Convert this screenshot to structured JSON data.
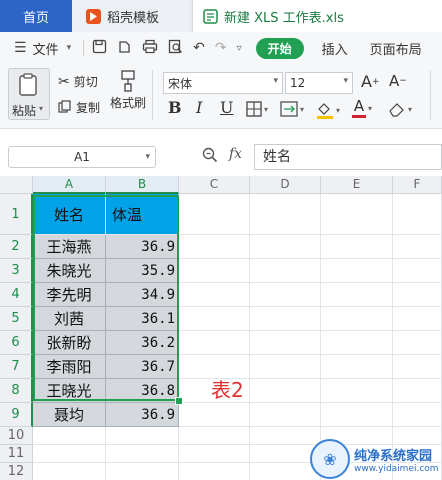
{
  "tabs": [
    {
      "label": "首页",
      "active": false
    },
    {
      "label": "稻壳模板",
      "active": false
    },
    {
      "label": "新建 XLS 工作表.xls",
      "active": true
    }
  ],
  "menu": {
    "file": "文件",
    "start": "开始",
    "insert": "插入",
    "layout": "页面布局"
  },
  "ribbon": {
    "paste": "粘贴",
    "cut": "剪切",
    "copy": "复制",
    "format_painter": "格式刷",
    "font_name": "宋体",
    "font_size": "12",
    "bold": "B",
    "italic": "I",
    "underline": "U",
    "grow_font": "A",
    "shrink_font": "A"
  },
  "formula_bar": {
    "cell_ref": "A1",
    "fx": "fx",
    "content": "姓名"
  },
  "sheet": {
    "columns": [
      "A",
      "B",
      "C",
      "D",
      "E",
      "F"
    ],
    "rows": [
      "1",
      "2",
      "3",
      "4",
      "5",
      "6",
      "7",
      "8",
      "9",
      "10",
      "11",
      "12"
    ],
    "header": [
      "姓名",
      "体温"
    ],
    "data": [
      [
        "王海燕",
        "36.9"
      ],
      [
        "朱晓光",
        "35.9"
      ],
      [
        "李先明",
        "34.9"
      ],
      [
        "刘茜",
        "36.1"
      ],
      [
        "张新盼",
        "36.2"
      ],
      [
        "李雨阳",
        "36.7"
      ],
      [
        "王晓光",
        "36.8"
      ],
      [
        "聂均",
        "36.9"
      ]
    ],
    "annotation": "表2",
    "header_fill": "#00a2e8",
    "body_fill": "#d4d7dc",
    "selection_color": "#21a053"
  },
  "watermark": {
    "title": "纯净系统家园",
    "url": "www.yidaimei.com"
  }
}
